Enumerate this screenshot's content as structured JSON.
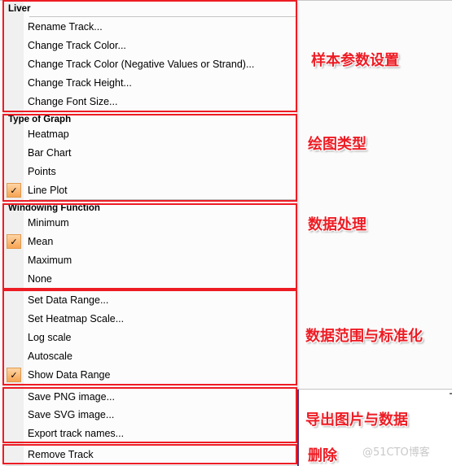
{
  "menu": {
    "sections": [
      {
        "header": "Liver",
        "items": [
          {
            "label": "Rename Track...",
            "checked": false
          },
          {
            "label": "Change Track Color...",
            "checked": false
          },
          {
            "label": "Change Track Color (Negative Values or Strand)...",
            "checked": false
          },
          {
            "label": "Change Track Height...",
            "checked": false
          },
          {
            "label": "Change Font Size...",
            "checked": false
          }
        ]
      },
      {
        "header": "Type of Graph",
        "items": [
          {
            "label": "Heatmap",
            "checked": false
          },
          {
            "label": "Bar Chart",
            "checked": false
          },
          {
            "label": "Points",
            "checked": false
          },
          {
            "label": "Line Plot",
            "checked": true
          }
        ]
      },
      {
        "header": "Windowing Function",
        "items": [
          {
            "label": "Minimum",
            "checked": false
          },
          {
            "label": "Mean",
            "checked": true
          },
          {
            "label": "Maximum",
            "checked": false
          },
          {
            "label": "None",
            "checked": false
          }
        ]
      },
      {
        "header": "",
        "items": [
          {
            "label": "Set Data Range...",
            "checked": false
          },
          {
            "label": "Set Heatmap Scale...",
            "checked": false
          },
          {
            "label": "Log scale",
            "checked": false
          },
          {
            "label": "Autoscale",
            "checked": false
          },
          {
            "label": "Show Data Range",
            "checked": true
          }
        ]
      },
      {
        "header": "",
        "items": [
          {
            "label": "Save PNG image...",
            "checked": false
          },
          {
            "label": "Save SVG image...",
            "checked": false
          },
          {
            "label": "Export track names...",
            "checked": false
          }
        ]
      },
      {
        "header": "",
        "items": [
          {
            "label": "Remove Track",
            "checked": false
          }
        ]
      }
    ],
    "check_glyph": "✓"
  },
  "annotations": [
    "样本参数设置",
    "绘图类型",
    "数据处理",
    "数据范围与标准化",
    "导出图片与数据",
    "删除"
  ],
  "watermark": "@51CTO博客",
  "colors": {
    "annotation_red": "#ed1c24",
    "check_orange": "#f7a353"
  }
}
